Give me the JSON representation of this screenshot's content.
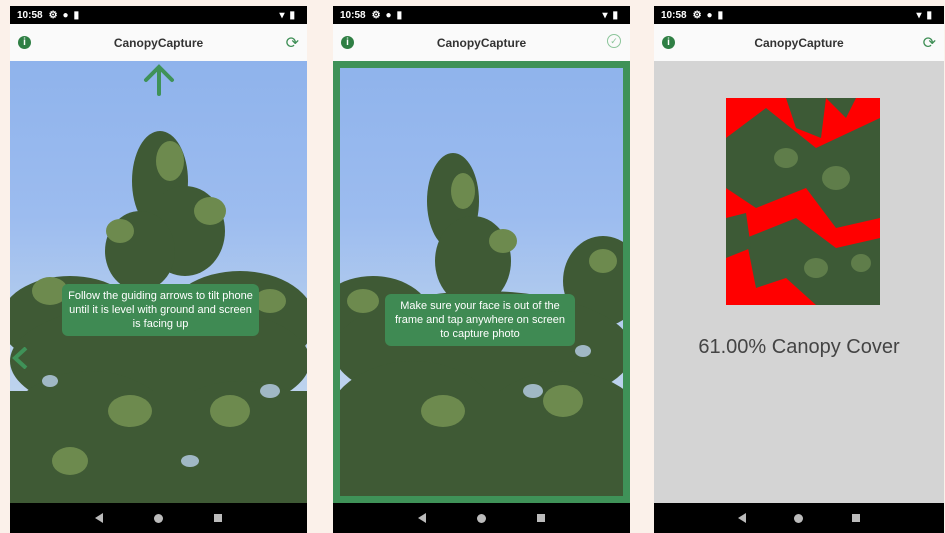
{
  "screens": [
    {
      "status_time": "10:58",
      "title": "CanopyCapture",
      "info_icon": "info-icon",
      "action_icon": "refresh-icon",
      "instruction": "Follow the guiding arrows to tilt phone until it is level with ground and screen is facing up"
    },
    {
      "status_time": "10:58",
      "title": "CanopyCapture",
      "info_icon": "info-icon",
      "action_icon": "check-circle-icon",
      "instruction": "Make sure your face is out of the frame and tap anywhere on screen to capture photo"
    },
    {
      "status_time": "10:58",
      "title": "CanopyCapture",
      "info_icon": "info-icon",
      "action_icon": "refresh-icon",
      "result": "61.00% Canopy Cover"
    }
  ],
  "colors": {
    "accent_green": "#3f8a53",
    "canopy_highlight": "#ff0000",
    "result_background": "#d4d4d4"
  }
}
